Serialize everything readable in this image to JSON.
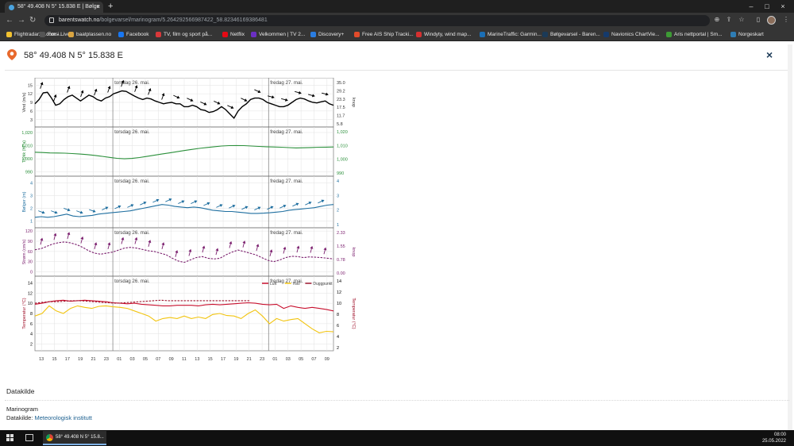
{
  "browser": {
    "tab_title": "58° 49.408 N 5° 15.838 E | Bølge",
    "tab_close": "×",
    "new_tab": "+",
    "url_host": "barentswatch.no",
    "url_path": "/bolgevarsel/marinogram/5.264292566987422_58.82346169386481",
    "window_controls": [
      "–",
      "□",
      "×"
    ],
    "bookmarks": [
      {
        "label": "Flightradar24.com - Live...",
        "icon_color": "#f2c230"
      },
      {
        "label": "Forsi...",
        "icon_color": "#555555"
      },
      {
        "label": "baatplassen.no",
        "icon_color": "#d9a441"
      },
      {
        "label": "Facebook",
        "icon_color": "#1877f2"
      },
      {
        "label": "TV, film og sport på...",
        "icon_color": "#d8383a"
      },
      {
        "label": "Netflix",
        "icon_color": "#e50914"
      },
      {
        "label": "Velkommen | TV 2...",
        "icon_color": "#6b2fc4"
      },
      {
        "label": "Discovery+",
        "icon_color": "#2a7de1"
      },
      {
        "label": "Free AIS Ship Tracki...",
        "icon_color": "#e24b2a"
      },
      {
        "label": "Windyty, wind map...",
        "icon_color": "#d63030"
      },
      {
        "label": "MarineTraffic: Garmin...",
        "icon_color": "#1b6fb6"
      },
      {
        "label": "Bølgevarsel - Baren...",
        "icon_color": "#1b3a57"
      },
      {
        "label": "Navionics ChartVie...",
        "icon_color": "#153a6b"
      },
      {
        "label": "Aris nettportal | Sm...",
        "icon_color": "#3d9b35"
      },
      {
        "label": "Norgeskart",
        "icon_color": "#2e7db5"
      }
    ]
  },
  "header": {
    "title": "58° 49.408 N 5° 15.838 E",
    "close": "×"
  },
  "chart_data": {
    "type": "line",
    "x_tick_labels": [
      "13",
      "15",
      "17",
      "19",
      "21",
      "23",
      "01",
      "03",
      "05",
      "07",
      "09",
      "11",
      "13",
      "15",
      "17",
      "19",
      "21",
      "23",
      "01",
      "03",
      "05",
      "07",
      "09"
    ],
    "day_labels": [
      "torsdag 26. mai.",
      "fredag 27. mai."
    ],
    "panels": [
      {
        "name": "wind",
        "ylabel_left": "Vind (m/s)",
        "ylabel_right": "knop",
        "ticks_left": [
          "15",
          "12",
          "9",
          "6",
          "3"
        ],
        "ticks_left_values": [
          15,
          12,
          9,
          6,
          3
        ],
        "ticks_right": [
          "35.0",
          "29.2",
          "23.3",
          "17.5",
          "11.7",
          "5.8"
        ],
        "ylim": [
          1,
          17
        ],
        "color": "#000000",
        "series": [
          {
            "values": [
              8.5,
              10,
              12.3,
              12.5,
              10.5,
              8,
              8.5,
              10,
              11,
              11.5,
              10.5,
              9.5,
              10.5,
              11.5,
              11,
              10,
              9.5,
              10.5,
              11,
              12,
              12.5,
              13,
              12.8,
              12,
              11.2,
              10.5,
              10,
              10.5,
              10.2,
              9.5,
              9,
              8.5,
              8.8,
              9,
              8.5,
              8.5,
              7.5,
              7.5,
              8,
              7.5,
              6.5,
              6.2,
              5.5,
              5.8,
              6.5,
              7.5,
              6.5,
              5,
              3.5,
              6,
              7.5,
              8.5,
              10,
              10.5,
              10.5,
              10,
              9,
              8.5,
              8,
              7.5,
              7.5,
              8,
              9,
              10,
              10.5,
              10.2,
              9.5,
              9,
              8.8,
              9.2,
              9.5,
              8.5,
              8
            ]
          }
        ]
      },
      {
        "name": "pressure",
        "ylabel_left": "Trykk (hPa)",
        "ticks_left": [
          "1,020",
          "1,010",
          "1,000",
          "990"
        ],
        "ticks_left_values": [
          1020,
          1010,
          1000,
          990
        ],
        "ticks_right": [
          "1,020",
          "1,010",
          "1,000",
          "990"
        ],
        "ylim": [
          988,
          1023
        ],
        "color": "#2a8f3a",
        "series": [
          {
            "values": [
              1005,
              1004.8,
              1004.5,
              1004.4,
              1004.3,
              1004,
              1003.6,
              1003.2,
              1002.6,
              1001.9,
              1001.1,
              1000.4,
              1000,
              1000.3,
              1001,
              1001.8,
              1002.7,
              1003.6,
              1004.5,
              1005.4,
              1006.3,
              1007.1,
              1007.9,
              1008.6,
              1009.2,
              1009.7,
              1010,
              1010.1,
              1010,
              1009.7,
              1009.4,
              1009.2,
              1009,
              1008.8,
              1008.5,
              1008.3,
              1008.4,
              1008.6,
              1008.8,
              1008.9,
              1009
            ]
          }
        ]
      },
      {
        "name": "waves",
        "ylabel_left": "Bølger (m)",
        "ticks_left": [
          "4",
          "3",
          "2",
          "1"
        ],
        "ticks_left_values": [
          4,
          3,
          2,
          1
        ],
        "ticks_right": [
          "4",
          "3",
          "2",
          "1"
        ],
        "ylim": [
          0.6,
          4.4
        ],
        "color": "#1f6fa0",
        "series": [
          {
            "values": [
              1.3,
              1.35,
              1.3,
              1.35,
              1.45,
              1.55,
              1.4,
              1.35,
              1.4,
              1.45,
              1.55,
              1.6,
              1.65,
              1.7,
              1.75,
              1.8,
              1.9,
              2.0,
              2.1,
              2.2,
              2.3,
              2.25,
              2.15,
              2.1,
              2.05,
              2.1,
              2.05,
              1.95,
              1.85,
              1.8,
              1.75,
              1.75,
              1.7,
              1.65,
              1.6,
              1.6,
              1.62,
              1.65,
              1.7,
              1.75,
              1.85,
              1.9,
              1.95,
              2.0,
              2.05,
              2.15,
              2.25,
              2.3
            ]
          }
        ]
      },
      {
        "name": "current",
        "ylabel_left": "Strøm (cm/s)",
        "ylabel_right": "knop",
        "ticks_left": [
          "120",
          "90",
          "60",
          "30",
          "0"
        ],
        "ticks_left_values": [
          120,
          90,
          60,
          30,
          0
        ],
        "ticks_right": [
          "2.33",
          "1.55",
          "0.78",
          "0.00"
        ],
        "ylim": [
          -8,
          125
        ],
        "color": "#7b1f6e",
        "series": [
          {
            "values": [
              65,
              68,
              75,
              82,
              86,
              88,
              85,
              80,
              72,
              62,
              55,
              52,
              55,
              58,
              64,
              70,
              72,
              70,
              66,
              62,
              60,
              55,
              50,
              40,
              32,
              28,
              35,
              42,
              45,
              40,
              38,
              40,
              50,
              58,
              64,
              60,
              55,
              50,
              42,
              34,
              30,
              35,
              42,
              46,
              45,
              42,
              44,
              43,
              42,
              40,
              38
            ]
          }
        ]
      },
      {
        "name": "temperature",
        "ylabel_left": "Temperatur (°C)",
        "ylabel_right": "Temperatur (°C)",
        "ticks_left": [
          "14",
          "12",
          "10",
          "8",
          "6",
          "4",
          "2"
        ],
        "ticks_left_values": [
          14,
          12,
          10,
          8,
          6,
          4,
          2
        ],
        "ticks_right": [
          "14",
          "12",
          "10",
          "8",
          "6",
          "4",
          "2"
        ],
        "ylim": [
          1,
          15
        ],
        "legend": [
          "Luft",
          "Hav",
          "Duggpunkt"
        ],
        "legend_colors": [
          "#c8102e",
          "#f2c40f",
          "#9e1830"
        ],
        "series": [
          {
            "name": "Luft",
            "color": "#c8102e",
            "values": [
              9.8,
              10,
              10.3,
              10.5,
              10.6,
              10.4,
              10.5,
              10.6,
              10.5,
              10.4,
              10.3,
              10.1,
              10,
              9.9,
              10,
              9.8,
              9.7,
              9.6,
              9.5,
              9.5,
              9.6,
              9.6,
              9.6,
              9.5,
              9.7,
              9.8,
              9.7,
              9.8,
              9.9,
              10,
              10.1,
              10,
              9.8,
              9.7,
              9.8,
              9,
              9.5,
              9.2,
              9.0,
              9.2,
              9.0,
              8.8,
              8.5
            ]
          },
          {
            "name": "Hav",
            "color": "#f2c40f",
            "values": [
              7.5,
              8,
              9.5,
              8.5,
              8,
              9,
              9.5,
              9.2,
              9,
              9.4,
              9.5,
              9.3,
              9.2,
              9,
              8.5,
              8,
              7.5,
              6.5,
              7,
              7.2,
              7,
              7.5,
              7,
              7.3,
              7,
              7.8,
              8,
              7.6,
              7.5,
              7,
              8,
              8.7,
              7.5,
              6,
              7,
              6.5,
              6.8,
              7,
              6,
              5,
              4.2,
              4.5,
              4.4
            ]
          },
          {
            "name": "Duggpunkt",
            "color": "#9e1830",
            "dashed": true,
            "values": [
              10,
              10.2,
              10.3,
              10.3,
              10.4,
              10.5,
              10.5,
              10.4,
              10.3,
              10.2,
              10.1,
              10,
              10.1,
              10.2,
              10.3,
              10.4,
              10.5,
              10.6,
              10.5,
              10.5,
              10.5,
              10.5,
              10.5,
              10.5,
              10.5,
              10.5,
              10.5,
              10.5,
              10.5,
              10.5
            ]
          }
        ]
      }
    ]
  },
  "data_source": {
    "heading": "Datakilde",
    "type": "Marinogram",
    "label": "Datakilde:",
    "provider": "Meteorologisk institutt"
  },
  "taskbar": {
    "app_label": "58° 49.408 N 5° 15.8...",
    "time": "08:00",
    "date": "25.05.2022"
  }
}
